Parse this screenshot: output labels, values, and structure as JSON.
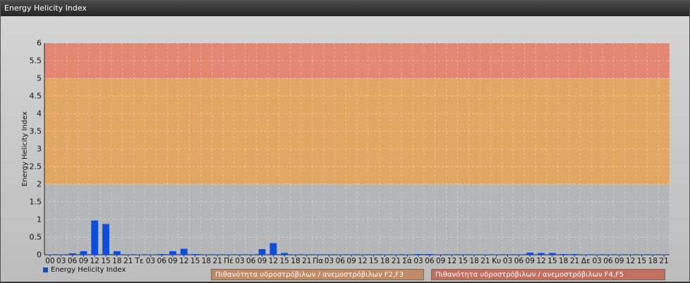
{
  "window": {
    "title": "Energy Helicity Index"
  },
  "colors": {
    "bar": "#0a4ee0",
    "band_f2f3": "#e7a45c",
    "band_f4f5": "#e8826a"
  },
  "legend": {
    "series_label": "Energy Helicity Index",
    "band1_label": "Πιθανότητα υδροστρόβιλων / ανεμοστρόβιλων F2,F3",
    "band2_label": "Πιθανότητα υδροστρόβιλων / ανεμοστρόβιλων F4,F5"
  },
  "chart_data": {
    "type": "bar",
    "ylabel": "Energy Helicity Index",
    "xlabel": "",
    "ylim": [
      0,
      6
    ],
    "yticks": [
      0,
      0.5,
      1,
      1.5,
      2,
      2.5,
      3,
      3.5,
      4,
      4.5,
      5,
      5.5,
      6
    ],
    "bands": [
      {
        "from": 2,
        "to": 5,
        "label": "Πιθανότητα υδροστρόβιλων / ανεμοστρόβιλων F2,F3"
      },
      {
        "from": 5,
        "to": 6,
        "label": "Πιθανότητα υδροστρόβιλων / ανεμοστρόβιλων F4,F5"
      }
    ],
    "categories": [
      "00",
      "03",
      "06",
      "09",
      "12",
      "15",
      "18",
      "21",
      "Τε",
      "03",
      "06",
      "09",
      "12",
      "15",
      "18",
      "21",
      "Πέ",
      "03",
      "06",
      "09",
      "12",
      "15",
      "18",
      "21",
      "Πα",
      "03",
      "06",
      "09",
      "12",
      "15",
      "18",
      "21",
      "Σά",
      "03",
      "06",
      "09",
      "12",
      "15",
      "18",
      "21",
      "Κυ",
      "03",
      "06",
      "09",
      "12",
      "15",
      "18",
      "21",
      "Δε",
      "03",
      "06",
      "09",
      "12",
      "15",
      "18",
      "21"
    ],
    "series": [
      {
        "name": "Energy Helicity Index",
        "values": [
          0.01,
          0.01,
          0.04,
          0.1,
          0.97,
          0.87,
          0.1,
          0.01,
          0.01,
          0.01,
          0.02,
          0.1,
          0.17,
          0.02,
          0.01,
          0.01,
          0.01,
          0.01,
          0.01,
          0.16,
          0.33,
          0.05,
          0.01,
          0.01,
          0.01,
          0.01,
          0.01,
          0.01,
          0.01,
          0.01,
          0.01,
          0.01,
          0.01,
          0.02,
          0.02,
          0.01,
          0.01,
          0.01,
          0.01,
          0.01,
          0.01,
          0.01,
          0.01,
          0.06,
          0.05,
          0.05,
          0.02,
          0.02,
          0.01,
          0.01,
          0.01,
          0.01,
          0.01,
          0.01,
          0.01,
          0.01
        ]
      }
    ]
  }
}
